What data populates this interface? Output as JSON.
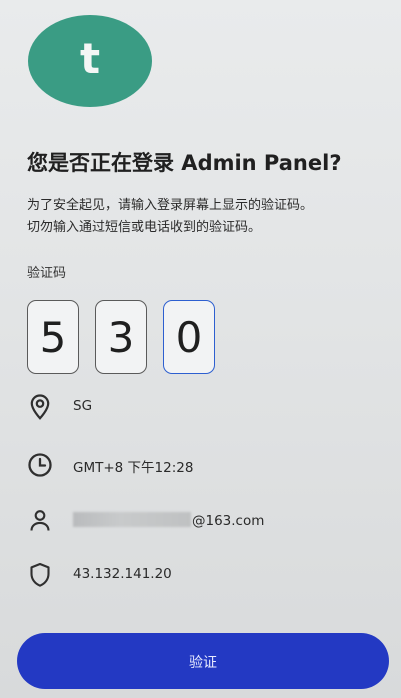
{
  "colors": {
    "avatar_bg": "#3a9c84",
    "primary_button": "#2339c3",
    "active_digit_border": "#2d5fd0"
  },
  "avatar": {
    "letter": "t"
  },
  "title": "您是否正在登录 Admin Panel?",
  "description": {
    "line1": "为了安全起见，请输入登录屏幕上显示的验证码。",
    "line2": "切勿输入通过短信或电话收到的验证码。"
  },
  "code": {
    "label": "验证码",
    "digits": [
      "5",
      "3",
      "0"
    ]
  },
  "info": {
    "location": {
      "icon": "location-pin-icon",
      "text": "SG"
    },
    "time": {
      "icon": "clock-icon",
      "text": "GMT+8 下午12:28"
    },
    "account": {
      "icon": "person-icon",
      "text": "@163.com"
    },
    "ip": {
      "icon": "shield-icon",
      "text": "43.132.141.20"
    }
  },
  "verify_button": {
    "label": "验证"
  }
}
